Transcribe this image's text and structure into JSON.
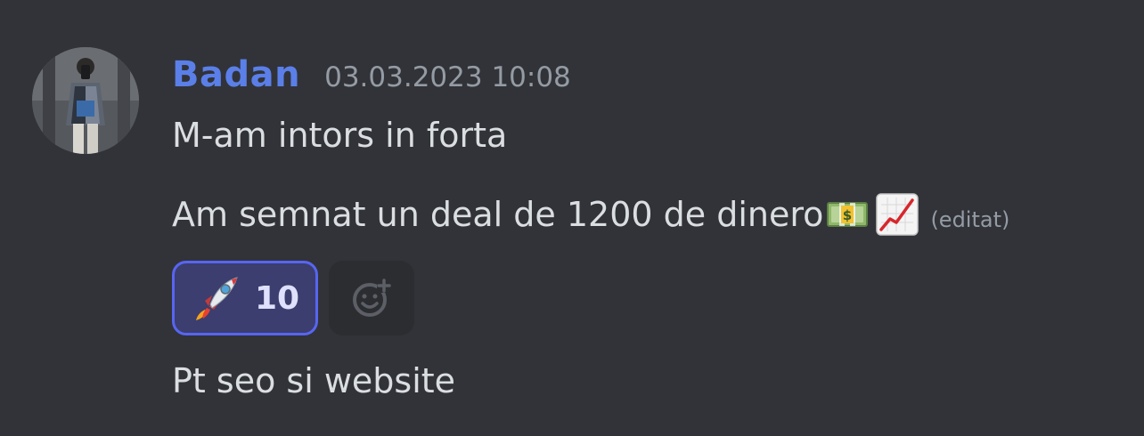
{
  "message": {
    "author": "Badan",
    "timestamp": "03.03.2023 10:08",
    "lines": [
      "M-am intors in forta",
      "Am semnat un deal de 1200 de dinero",
      "Pt seo si website"
    ],
    "line2_emojis": [
      "money-bill-emoji",
      "chart-increasing-emoji"
    ],
    "edited_label": "(editat)",
    "reactions": [
      {
        "emoji": "rocket-emoji",
        "count": "10",
        "selected": true
      }
    ]
  },
  "colors": {
    "background": "#313338",
    "username": "#5b7fe8",
    "text": "#dbdee1",
    "muted": "#949ba4",
    "reaction_bg": "#3b3e6e",
    "reaction_border": "#5865f2",
    "add_reaction_bg": "#2b2d31"
  }
}
